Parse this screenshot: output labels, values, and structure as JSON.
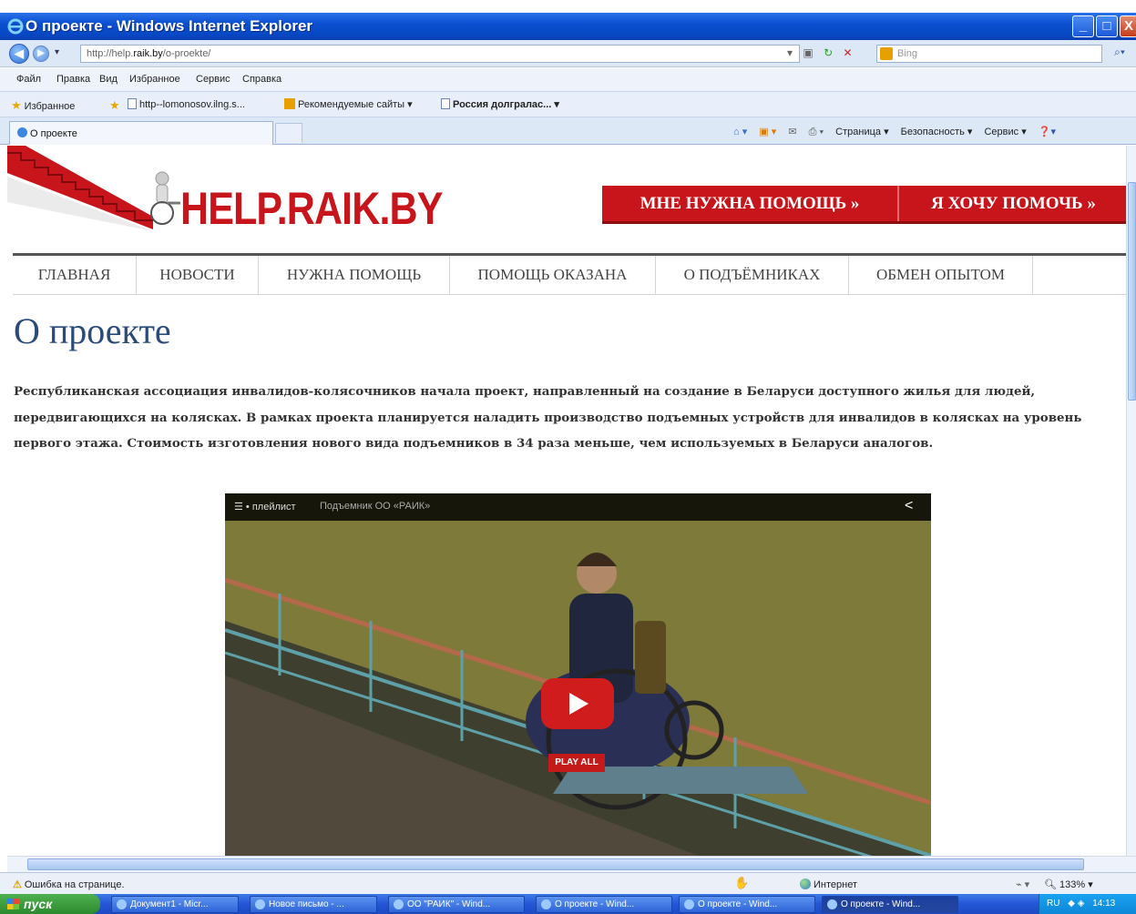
{
  "window": {
    "title": "О проекте - Windows Internet Explorer",
    "min_label": "_",
    "max_label": "□",
    "close_label": "X"
  },
  "addressbar": {
    "url_prefix": "http://help.",
    "url_domain": "raik.by",
    "url_suffix": "/o-proekte/",
    "search_placeholder": "Bing"
  },
  "menu": [
    "Файл",
    "Правка",
    "Вид",
    "Избранное",
    "Сервис",
    "Справка"
  ],
  "favorites": {
    "label": "Избранное",
    "items": [
      "http--lomonosov.ilng.s...",
      "Рекомендуемые сайты ▾",
      "Россия долгралас... ▾"
    ]
  },
  "tab": {
    "title": "О проекте"
  },
  "commandbar": [
    "Страница ▾",
    "Безопасность ▾",
    "Сервис ▾"
  ],
  "site": {
    "logo": "HELP.RAIK.BY",
    "cta_need_help": "МНЕ НУЖНА ПОМОЩЬ »",
    "cta_want_help": "Я ХОЧУ ПОМОЧЬ »",
    "nav": [
      "ГЛАВНАЯ",
      "НОВОСТИ",
      "НУЖНА ПОМОЩЬ",
      "ПОМОЩЬ ОКАЗАНА",
      "О ПОДЪЁМНИКАХ",
      "ОБМЕН ОПЫТОМ"
    ],
    "page_title": "О проекте",
    "intro": "Республиканская ассоциация инвалидов-колясочников начала проект, направленный на создание в Беларуси доступного жилья для людей, передвигающихся на колясках. В рамках проекта планируется наладить производство подъемных устройств для инвалидов в колясках на уровень первого этажа. Стоимость изготовления нового вида подъемников в 34 раза меньше, чем используемых в Беларуси аналогов."
  },
  "video": {
    "playlist_label": "☰ • плейлист",
    "video_title": "Подъемник ОО «РАИК»",
    "play_all": "PLAY ALL"
  },
  "statusbar": {
    "error": "Ошибка на странице.",
    "zone": "Интернет",
    "zoom": "133%"
  },
  "taskbar": {
    "start": "пуск",
    "items": [
      "Документ1 - Micr...",
      "Новое письмо - ...",
      "ОО \"РАИК\" - Wind...",
      "О проекте - Wind...",
      "О проекте - Wind...",
      "О проекте - Wind..."
    ],
    "clock": "14:13",
    "lang": "RU"
  },
  "colors": {
    "brand_red": "#c8151b",
    "title_blue": "#2a4a7a",
    "xp_blue": "#0a4fd0"
  }
}
